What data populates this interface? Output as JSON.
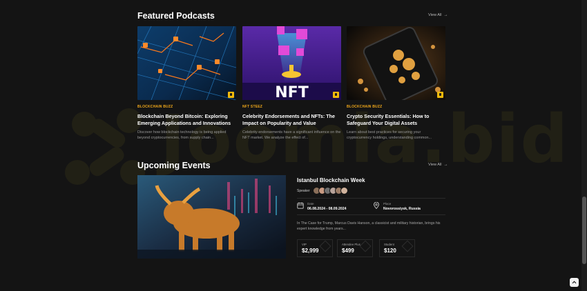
{
  "watermark": {
    "text": "Joomla.bid",
    "color": "#3b3717"
  },
  "featured": {
    "title": "Featured Podcasts",
    "view_all": "View All",
    "cards": [
      {
        "category": "BLOCKCHAIN BUZZ",
        "title": "Blockchain Beyond Bitcoin: Exploring Emerging Applications and Innovations",
        "description": "Discover how blockchain technology is being applied beyond cryptocurrencies, from supply chain...",
        "image_icon": "circuit-board-image",
        "badge_icon": "microphone-icon"
      },
      {
        "category": "NFT STEEZ",
        "title": "Celebrity Endorsements and NFTs: The Impact on Popularity and Value",
        "description": "Celebrity endorsements have a significant influence on the NFT market. We analyze the effect of...",
        "image_icon": "nft-image",
        "image_text": "NFT",
        "badge_icon": "microphone-icon"
      },
      {
        "category": "BLOCKCHAIN BUZZ",
        "title": "Crypto Security Essentials: How to Safeguard Your Digital Assets",
        "description": "Learn about best practices for securing your cryptocurrency holdings, understanding common...",
        "image_icon": "crypto-phone-image",
        "badge_icon": "microphone-icon"
      }
    ]
  },
  "events": {
    "title": "Upcoming Events",
    "view_all": "View All",
    "event": {
      "title": "Istanbul Blockchain Week",
      "speaker_label": "Speaker",
      "speakers": [
        "#8a6f5a",
        "#c99a82",
        "#6e6e6e",
        "#b8a39a",
        "#9c7c66",
        "#d1b39d"
      ],
      "date_label": "Date",
      "date_value": "06.08.2024 - 08.09.2024",
      "place_label": "Place",
      "place_value": "Novorossiysk, Russia",
      "description": "In The Case for Trump, Marcus Davis Hanson, a classicist and military historian, brings his expert knowledge from years...",
      "tickets": [
        {
          "label": "VIP",
          "price": "$2,999"
        },
        {
          "label": "Attendee Plus",
          "price": "$499"
        },
        {
          "label": "Student",
          "price": "$120"
        }
      ]
    }
  },
  "colors": {
    "accent": "#f0a81a",
    "background": "#141414"
  }
}
